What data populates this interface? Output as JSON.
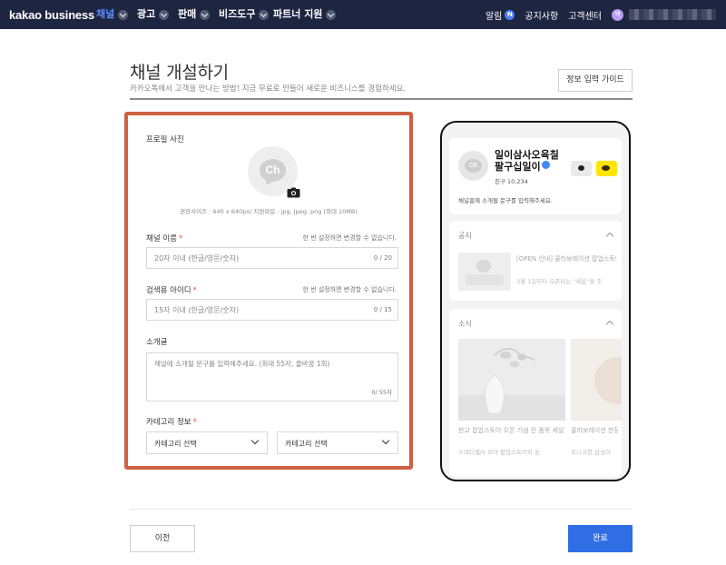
{
  "nav": {
    "logo": "kakao business",
    "menus": [
      {
        "label": "채널"
      },
      {
        "label": "광고"
      },
      {
        "label": "판매"
      },
      {
        "label": "비즈도구"
      },
      {
        "label": "파트너 지원"
      }
    ],
    "right": {
      "notifications": "알림",
      "notifications_badge": "N",
      "notices": "공지사항",
      "support": "고객센터",
      "avatar_letter": "백"
    }
  },
  "header": {
    "title": "채널 개설하기",
    "subtitle": "카카오톡에서 고객을 만나는 방법! 지금 무료로 만들어 새로운 비즈니스를 경험하세요.",
    "guide_button": "정보 입력 가이드"
  },
  "form": {
    "profile_label": "프로필 사진",
    "profile_placeholder": "Ch",
    "size_note": "권장사이즈 : 640 x 640px/ 지원파일 : jpg, jpeg, png (최대 10MB)",
    "channel_name": {
      "label": "채널 이름",
      "required": "*",
      "note": "한 번 설정하면 변경할 수 없습니다.",
      "placeholder": "20자 이내 (한글/영문/숫자)",
      "counter": "0 / 20"
    },
    "search_id": {
      "label": "검색용 아이디",
      "required": "*",
      "note": "한 번 설정하면 변경할 수 없습니다.",
      "placeholder": "15자 이내 (한글/영문/숫자)",
      "counter": "0 / 15"
    },
    "intro": {
      "label": "소개글",
      "placeholder": "채널에 소개될 문구를 입력해주세요. (최대 55자, 줄바꿈 1회)",
      "counter": "0/ 55자"
    },
    "category": {
      "label": "카테고리 정보",
      "required": "*",
      "select1": "카테고리 선택",
      "select2": "카테고리 선택"
    }
  },
  "preview": {
    "avatar_text": "Ch",
    "name": "일이삼사오육칠팔구십일이",
    "friends": "친구 10,234",
    "intro": "채널홈에 소개될 문구를 입력해주세요.",
    "notice_title": "공지",
    "notice_text": "[OPEN 안내] 콜라보레이션 팝업스토어 @판교",
    "notice_sub": "3월 1일부터 오픈되는 \"세움\"을 주",
    "news_title": "소식",
    "news1_title": "판교 팝업스토어 오픈 기념 전 품목 세일",
    "news1_sub": "스테디셀러 모아 팝업스토어와 온",
    "news2_title": "콜라보레이션 한정 출시",
    "news2_sub": "유니크한 감성이"
  },
  "footer": {
    "prev_button": "이전",
    "done_button": "완료"
  },
  "colors": {
    "nav_bg": "#1e2541",
    "nav_active": "#5c8dff",
    "highlight_border": "#cc6243",
    "primary_button": "#2f6ee5",
    "required": "#e4573d",
    "kakao_yellow": "#fee500"
  }
}
